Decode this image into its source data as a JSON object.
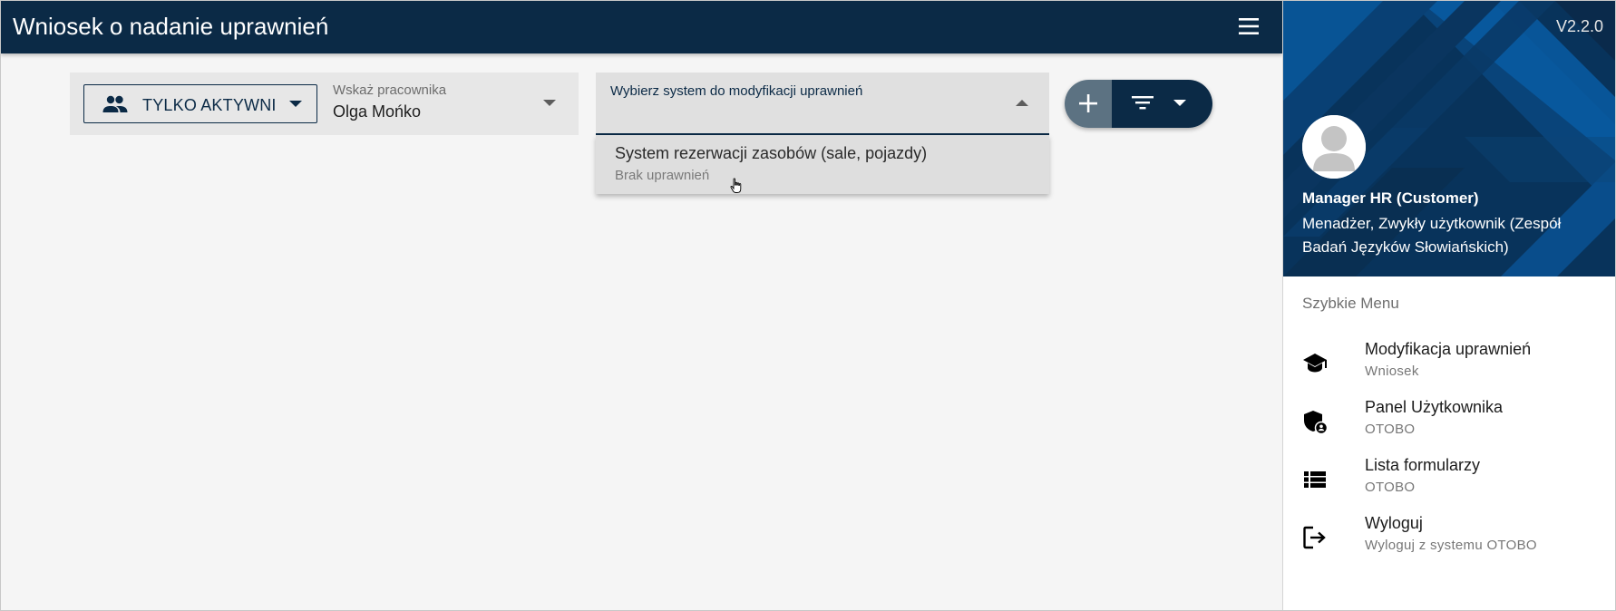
{
  "appbar": {
    "title": "Wniosek o nadanie uprawnień",
    "menu_icon": "hamburger-menu-icon"
  },
  "employee_filter": {
    "active_button_label": "TYLKO AKTYWNI",
    "active_button_icon": "people-icon",
    "employee_field_label": "Wskaż pracownika",
    "employee_field_value": "Olga Mońko"
  },
  "system_select": {
    "label": "Wybierz system do modyfikacji uprawnień",
    "value": "",
    "expanded": true,
    "options": [
      {
        "title": "System rezerwacji zasobów (sale, pojazdy)",
        "subtitle": "Brak uprawnień"
      }
    ]
  },
  "fab": {
    "add_icon": "plus-icon",
    "filter_icon": "filter-list-icon"
  },
  "drawer": {
    "version": "V2.2.0",
    "user_name": "Manager HR (Customer)",
    "user_roles": "Menadżer, Zwykły użytkownik (Zespół Badań Języków Słowiańskich)",
    "quick_menu_title": "Szybkie Menu",
    "quick_menu": [
      {
        "title": "Modyfikacja uprawnień",
        "subtitle": "Wniosek",
        "icon": "graduation-cap-icon"
      },
      {
        "title": "Panel Użytkownika",
        "subtitle": "OTOBO",
        "icon": "shield-account-icon"
      },
      {
        "title": "Lista formularzy",
        "subtitle": "OTOBO",
        "icon": "view-list-icon"
      },
      {
        "title": "Wyloguj",
        "subtitle": "Wyloguj z systemu OTOBO",
        "icon": "logout-icon"
      }
    ]
  },
  "colors": {
    "primary": "#0b2a46",
    "drawer_header": "#0a3a66",
    "fab_add": "#5c7282",
    "background": "#f5f5f5"
  }
}
